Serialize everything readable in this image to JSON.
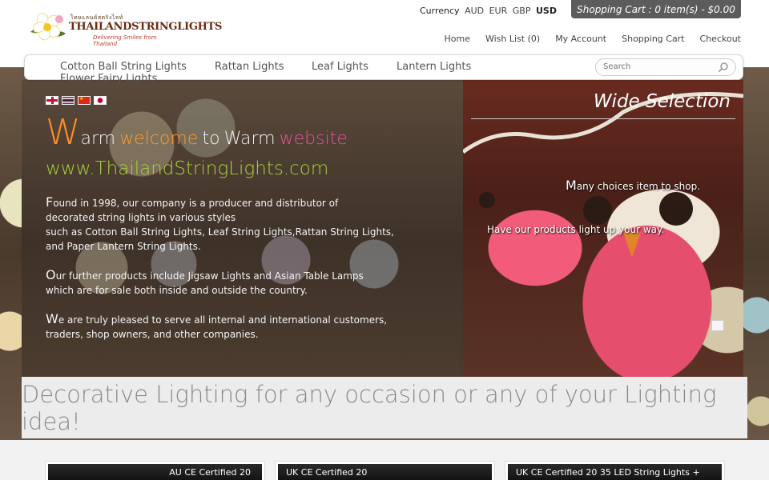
{
  "header": {
    "logo": {
      "thai_text": "ไทยแลนด์สตริงไลท์",
      "name": "THAILANDSTRINGLIGHTS",
      "tagline": "Delivering Smiles from Thailand"
    },
    "currency": {
      "label": "Currency",
      "options": [
        "AUD",
        "EUR",
        "GBP",
        "USD"
      ],
      "selected": "USD"
    },
    "cart": "Shopping Cart : 0 item(s) - $0.00",
    "links": [
      "Home",
      "Wish List (0)",
      "My Account",
      "Shopping Cart",
      "Checkout"
    ]
  },
  "nav": {
    "items": [
      "Cotton Ball String Lights",
      "Rattan Lights",
      "Leaf Lights",
      "Lantern Lights",
      "Flower Fairy Lights"
    ],
    "search_placeholder": "Search"
  },
  "hero": {
    "flags": [
      "english-flag",
      "thai-flag",
      "chinese-flag",
      "japanese-flag"
    ],
    "welcome": {
      "w_big": "W",
      "arm": "arm",
      "welcome": "welcome",
      "to": "to",
      "warm": "Warm",
      "website": "website"
    },
    "site_url": "www.ThailandStringLights.com",
    "para1": {
      "cap": "F",
      "line1": "ound in 1998, our company is a producer and distributor of",
      "line2": "decorated string lights in various styles",
      "line3": "such as Cotton Ball String Lights, Leaf String Lights,Rattan String Lights,",
      "line4": "and Paper Lantern String Lights."
    },
    "para2": {
      "cap": "O",
      "line1": "ur further products include Jigsaw Lights and Asian Table Lamps",
      "line2": "which are for sale both inside and outside the country."
    },
    "para3": {
      "cap": "W",
      "line1": "e are truly pleased to serve all internal and international customers,",
      "line2": "traders, shop owners, and other companies."
    },
    "slide": {
      "title": "Wide Selection",
      "choice_cap": "M",
      "choice_rest": "any choices item to shop.",
      "line2": "Have our products light up your way."
    }
  },
  "banner": "Decorative Lighting for any occasion or any of your Lighting idea!",
  "products": [
    {
      "title": "AU CE Certified 20"
    },
    {
      "title": "UK CE Certified 20"
    },
    {
      "title": "UK CE Certified 20 35 LED String Lights +"
    }
  ]
}
